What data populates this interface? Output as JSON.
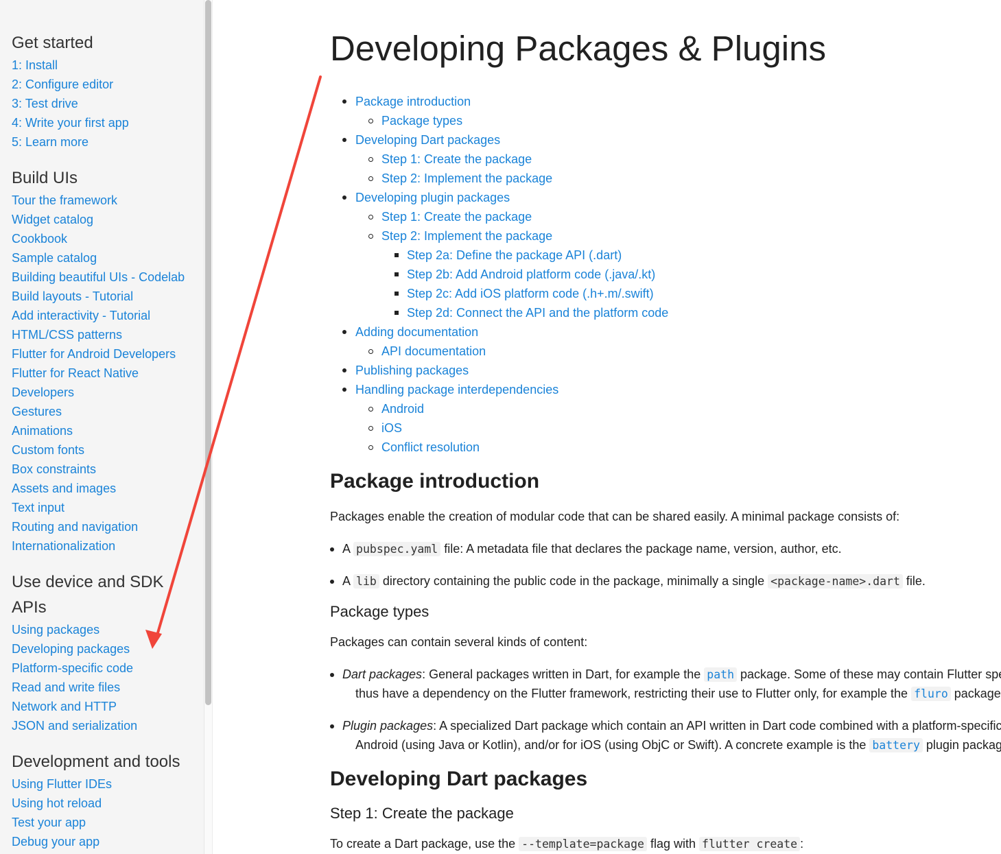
{
  "sidebar": {
    "sections": [
      {
        "heading": "Get started",
        "items": [
          "1: Install",
          "2: Configure editor",
          "3: Test drive",
          "4: Write your first app",
          "5: Learn more"
        ]
      },
      {
        "heading": "Build UIs",
        "items": [
          "Tour the framework",
          "Widget catalog",
          "Cookbook",
          "Sample catalog",
          "Building beautiful UIs - Codelab",
          "Build layouts - Tutorial",
          "Add interactivity - Tutorial",
          "HTML/CSS patterns",
          "Flutter for Android Developers",
          "Flutter for React Native",
          "Developers",
          "Gestures",
          "Animations",
          "Custom fonts",
          "Box constraints",
          "Assets and images",
          "Text input",
          "Routing and navigation",
          "Internationalization"
        ]
      },
      {
        "heading_line1": "Use device and SDK",
        "heading_line2": "APIs",
        "items": [
          "Using packages",
          "Developing packages",
          "Platform-specific code",
          "Read and write files",
          "Network and HTTP",
          "JSON and serialization"
        ]
      },
      {
        "heading": "Development and tools",
        "items": [
          "Using Flutter IDEs",
          "Using hot reload",
          "Test your app",
          "Debug your app"
        ]
      }
    ]
  },
  "main": {
    "title": "Developing Packages & Plugins",
    "toc": [
      {
        "level": 1,
        "label": "Package introduction"
      },
      {
        "level": 2,
        "label": "Package types"
      },
      {
        "level": 1,
        "label": "Developing Dart packages"
      },
      {
        "level": 2,
        "label": "Step 1: Create the package"
      },
      {
        "level": 2,
        "label": "Step 2: Implement the package"
      },
      {
        "level": 1,
        "label": "Developing plugin packages"
      },
      {
        "level": 2,
        "label": "Step 1: Create the package"
      },
      {
        "level": 2,
        "label": "Step 2: Implement the package"
      },
      {
        "level": 3,
        "label": "Step 2a: Define the package API (.dart)"
      },
      {
        "level": 3,
        "label": "Step 2b: Add Android platform code (.java/.kt)"
      },
      {
        "level": 3,
        "label": "Step 2c: Add iOS platform code (.h+.m/.swift)"
      },
      {
        "level": 3,
        "label": "Step 2d: Connect the API and the platform code"
      },
      {
        "level": 1,
        "label": "Adding documentation"
      },
      {
        "level": 2,
        "label": "API documentation"
      },
      {
        "level": 1,
        "label": "Publishing packages"
      },
      {
        "level": 1,
        "label": "Handling package interdependencies"
      },
      {
        "level": 2,
        "label": "Android"
      },
      {
        "level": 2,
        "label": "iOS"
      },
      {
        "level": 2,
        "label": "Conflict resolution"
      }
    ],
    "intro": {
      "heading": "Package introduction",
      "text": "Packages enable the creation of modular code that can be shared easily. A minimal package consists of:",
      "bullet1": {
        "pre": "A ",
        "code": "pubspec.yaml",
        "post": " file: A metadata file that declares the package name, version, author, etc."
      },
      "bullet2": {
        "pre": "A ",
        "code": "lib",
        "mid": " directory containing the public code in the package, minimally a single ",
        "code2": "<package-name>.dart",
        "post": " file."
      }
    },
    "types": {
      "heading": "Package types",
      "text": "Packages can contain several kinds of content:",
      "dart": {
        "em": "Dart packages",
        "line1_a": ": General packages written in Dart, for example the ",
        "line1_code": "path",
        "line1_b": " package. Some of these may contain Flutter specific functionality and",
        "line2_a": "thus have a dependency on the Flutter framework, restricting their use to Flutter only, for example the ",
        "line2_code": "fluro",
        "line2_b": " package."
      },
      "plugin": {
        "em": "Plugin packages",
        "line1": ": A specialized Dart package which contain an API written in Dart code combined with a platform-specific implementation for",
        "line2_a": "Android (using Java or Kotlin), and/or for iOS (using ObjC or Swift). A concrete example is the ",
        "line2_code": "battery",
        "line2_b": " plugin package."
      }
    },
    "dart_pkgs": {
      "heading": "Developing Dart packages",
      "step1": "Step 1: Create the package",
      "text_a": "To create a Dart package, use the ",
      "code1": "--template=package",
      "text_b": " flag with ",
      "code2": "flutter create",
      "text_c": ":"
    }
  },
  "colors": {
    "link": "#1a83d8",
    "arrow": "#f0453a",
    "sidebar_bg": "#f5f5f5"
  }
}
